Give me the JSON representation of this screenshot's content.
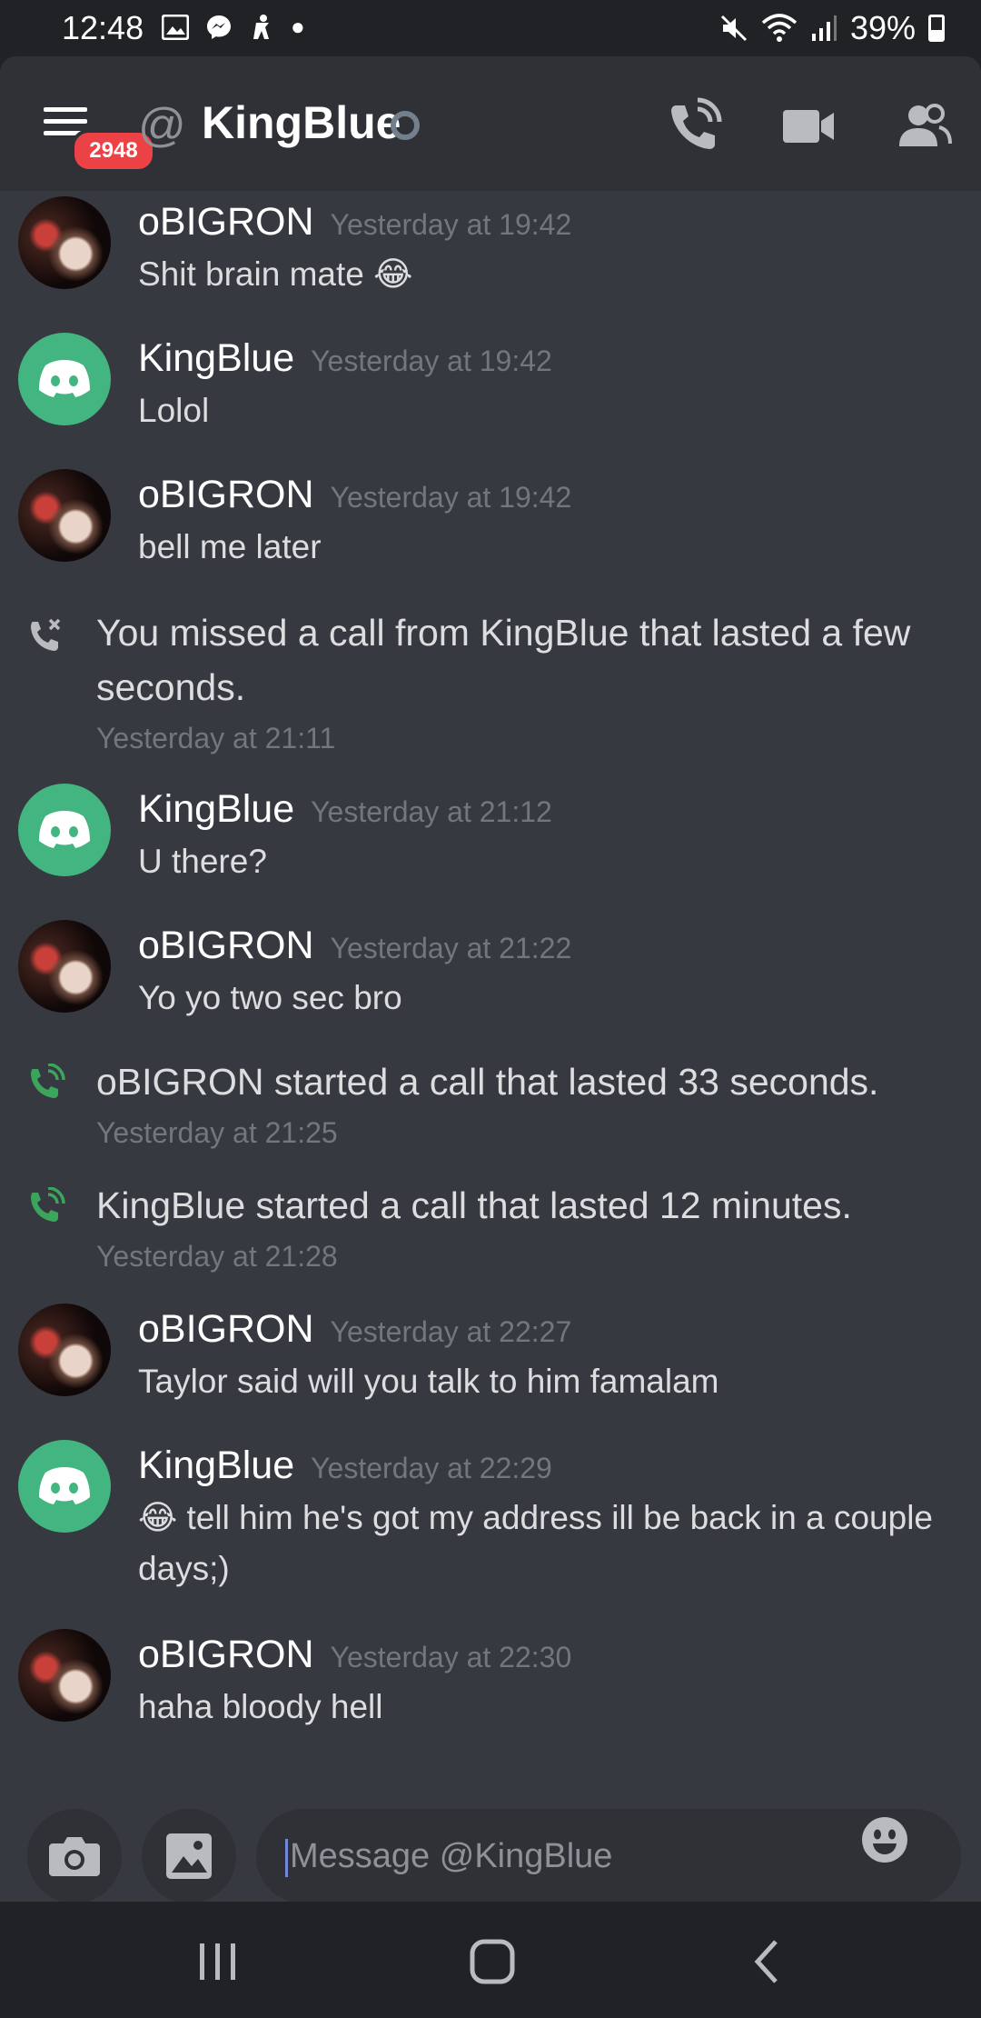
{
  "status_bar": {
    "time": "12:48",
    "battery": "39%",
    "icons": [
      "gallery-icon",
      "messenger-icon",
      "accessibility-icon",
      "dot-icon",
      "mute-icon",
      "wifi-icon",
      "signal-icon",
      "battery-icon"
    ]
  },
  "header": {
    "badge_count": "2948",
    "at_symbol": "@",
    "title": "KingBlue",
    "buttons": [
      "voice-call-icon",
      "video-call-icon",
      "members-icon"
    ]
  },
  "messages": [
    {
      "kind": "msg",
      "author": "oBIGRON",
      "timestamp": "Yesterday at 19:42",
      "body": "Shit brain mate 😂",
      "avatar": "photo"
    },
    {
      "kind": "msg",
      "author": "KingBlue",
      "timestamp": "Yesterday at 19:42",
      "body": "Lolol",
      "avatar": "discord"
    },
    {
      "kind": "msg",
      "author": "oBIGRON",
      "timestamp": "Yesterday at 19:42",
      "body": "bell me later",
      "avatar": "photo"
    },
    {
      "kind": "sys",
      "icon": "missed-call",
      "text": "You missed a call from KingBlue that lasted a few seconds.",
      "timestamp": "Yesterday at 21:11"
    },
    {
      "kind": "msg",
      "author": "KingBlue",
      "timestamp": "Yesterday at 21:12",
      "body": "U there?",
      "avatar": "discord"
    },
    {
      "kind": "msg",
      "author": "oBIGRON",
      "timestamp": "Yesterday at 21:22",
      "body": "Yo yo two sec bro",
      "avatar": "photo"
    },
    {
      "kind": "sys",
      "icon": "call",
      "text": "oBIGRON started a call that lasted 33 seconds.",
      "timestamp": "Yesterday at 21:25"
    },
    {
      "kind": "sys",
      "icon": "call",
      "text": "KingBlue started a call that lasted 12 minutes.",
      "timestamp": "Yesterday at 21:28"
    },
    {
      "kind": "msg",
      "author": "oBIGRON",
      "timestamp": "Yesterday at 22:27",
      "body": "Taylor said will you talk to him famalam",
      "avatar": "photo"
    },
    {
      "kind": "msg",
      "author": "KingBlue",
      "timestamp": "Yesterday at 22:29",
      "body": "😂 tell him he's got my address ill be back in a couple days;)",
      "avatar": "discord"
    },
    {
      "kind": "msg",
      "author": "oBIGRON",
      "timestamp": "Yesterday at 22:30",
      "body": "haha bloody hell",
      "avatar": "photo"
    }
  ],
  "composer": {
    "placeholder": "Message @KingBlue"
  },
  "colors": {
    "background": "#36393f",
    "header": "#2f3136",
    "badge": "#ed4245",
    "discord_green": "#43b581",
    "call_green": "#3ba55c",
    "timestamp": "#72767d"
  }
}
